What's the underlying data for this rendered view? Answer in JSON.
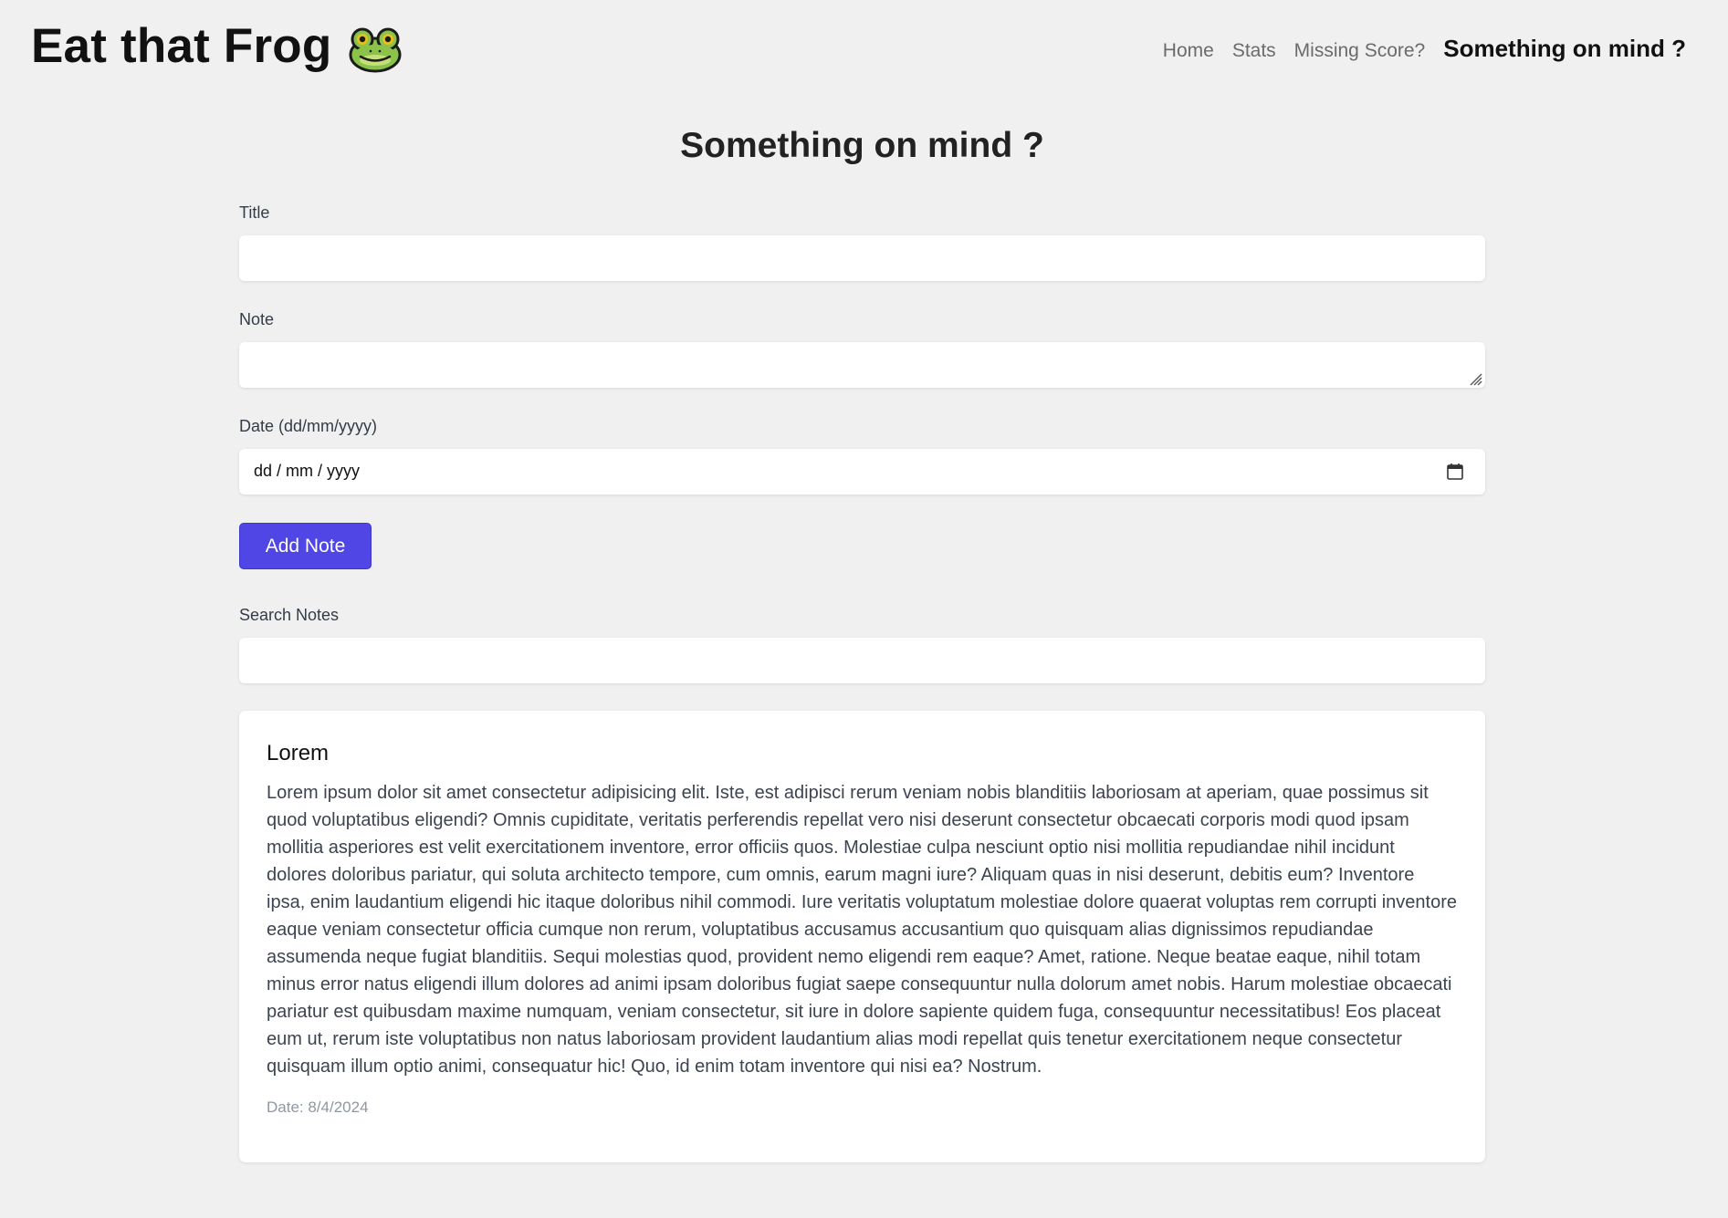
{
  "header": {
    "brand": "Eat that Frog",
    "nav": [
      "Home",
      "Stats",
      "Missing Score?",
      "Something on mind ?"
    ]
  },
  "page_title": "Something on mind ?",
  "form": {
    "title_label": "Title",
    "title_value": "",
    "note_label": "Note",
    "note_value": "",
    "date_label": "Date (dd/mm/yyyy)",
    "date_placeholder": "dd / mm / yyyy",
    "add_button": "Add Note"
  },
  "search": {
    "label": "Search Notes",
    "value": ""
  },
  "notes": [
    {
      "title": "Lorem",
      "body": "Lorem ipsum dolor sit amet consectetur adipisicing elit. Iste, est adipisci rerum veniam nobis blanditiis laboriosam at aperiam, quae possimus sit quod voluptatibus eligendi? Omnis cupiditate, veritatis perferendis repellat vero nisi deserunt consectetur obcaecati corporis modi quod ipsam mollitia asperiores est velit exercitationem inventore, error officiis quos. Molestiae culpa nesciunt optio nisi mollitia repudiandae nihil incidunt dolores doloribus pariatur, qui soluta architecto tempore, cum omnis, earum magni iure? Aliquam quas in nisi deserunt, debitis eum? Inventore ipsa, enim laudantium eligendi hic itaque doloribus nihil commodi. Iure veritatis voluptatum molestiae dolore quaerat voluptas rem corrupti inventore eaque veniam consectetur officia cumque non rerum, voluptatibus accusamus accusantium quo quisquam alias dignissimos repudiandae assumenda neque fugiat blanditiis. Sequi molestias quod, provident nemo eligendi rem eaque? Amet, ratione. Neque beatae eaque, nihil totam minus error natus eligendi illum dolores ad animi ipsam doloribus fugiat saepe consequuntur nulla dolorum amet nobis. Harum molestiae obcaecati pariatur est quibusdam maxime numquam, veniam consectetur, sit iure in dolore sapiente quidem fuga, consequuntur necessitatibus! Eos placeat eum ut, rerum iste voluptatibus non natus laboriosam provident laudantium alias modi repellat quis tenetur exercitationem neque consectetur quisquam illum optio animi, consequatur hic! Quo, id enim totam inventore qui nisi ea? Nostrum.",
      "date": "Date: 8/4/2024"
    }
  ],
  "colors": {
    "background": "#f0f0f0",
    "accent": "#4f46e5",
    "card": "#ffffff"
  },
  "icons": [
    "frog-icon",
    "calendar-icon",
    "resize-grip-icon"
  ]
}
